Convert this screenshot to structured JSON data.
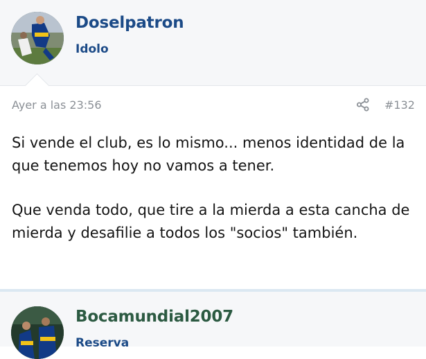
{
  "posts": [
    {
      "author": "Doselpatron",
      "user_title": "Idolo",
      "avatar_icon": "user-avatar-photo",
      "timestamp": "Ayer a las 23:56",
      "post_number": "#132",
      "body": [
        "Si vende el club, es lo mismo... menos identidad de la que tenemos hoy no vamos a tener.",
        "Que venda todo, que tire a la mierda a esta cancha de mierda y desafilie a todos los \"socios\" también."
      ]
    },
    {
      "author": "Bocamundial2007",
      "user_title": "Reserva",
      "avatar_icon": "user-avatar-photo"
    }
  ],
  "colors": {
    "username_blue": "#1b4a87",
    "username_green": "#2c5a42",
    "meta_gray": "#8a8f95",
    "header_bg": "#f6f7f9"
  },
  "icons": {
    "share": "share-icon"
  }
}
